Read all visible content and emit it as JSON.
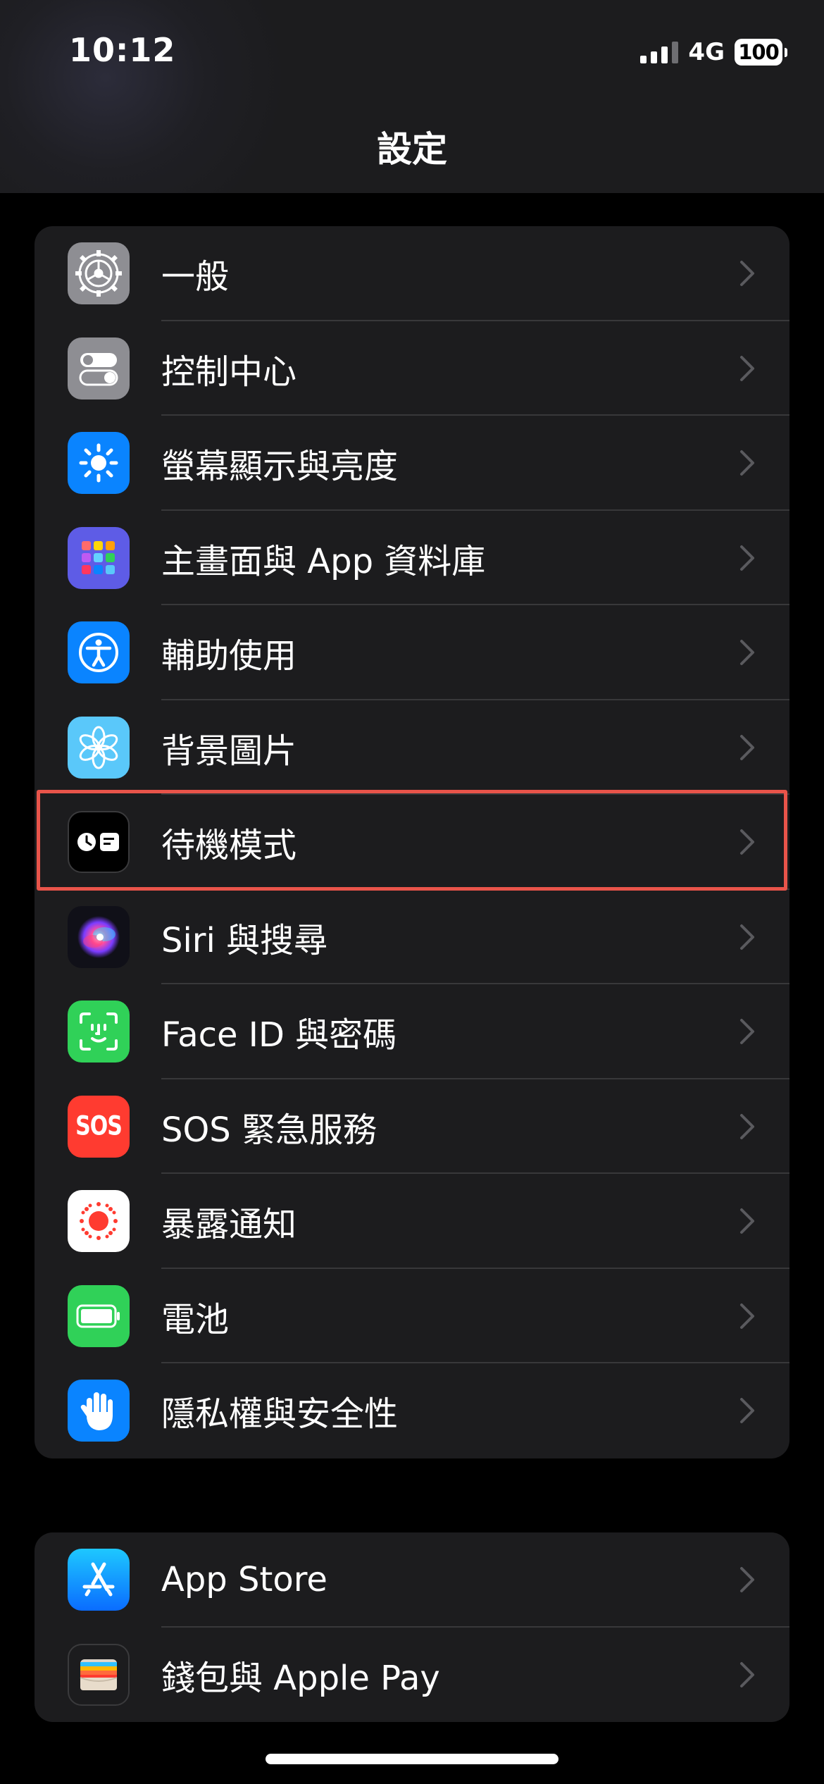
{
  "status_bar": {
    "time": "10:12",
    "network": "4G",
    "battery": "100"
  },
  "nav": {
    "title": "設定"
  },
  "group1": [
    {
      "id": "general",
      "label": "一般",
      "icon": "gear-icon",
      "color": "#8e8e93"
    },
    {
      "id": "control-center",
      "label": "控制中心",
      "icon": "toggles-icon",
      "color": "#8e8e93"
    },
    {
      "id": "display-brightness",
      "label": "螢幕顯示與亮度",
      "icon": "sun-icon",
      "color": "#0a84ff"
    },
    {
      "id": "home-screen",
      "label": "主畫面與 App 資料庫",
      "icon": "app-grid-icon",
      "color": "#5e5ce6"
    },
    {
      "id": "accessibility",
      "label": "輔助使用",
      "icon": "accessibility-icon",
      "color": "#0a84ff"
    },
    {
      "id": "wallpaper",
      "label": "背景圖片",
      "icon": "flower-icon",
      "color": "#5ac8fa"
    },
    {
      "id": "standby",
      "label": "待機模式",
      "icon": "standby-icon",
      "color": "#000000"
    },
    {
      "id": "siri",
      "label": "Siri 與搜尋",
      "icon": "siri-icon",
      "color": "#1b1b2e"
    },
    {
      "id": "face-id",
      "label": "Face ID 與密碼",
      "icon": "face-id-icon",
      "color": "#30d158"
    },
    {
      "id": "sos",
      "label": "SOS 緊急服務",
      "icon": "sos-icon",
      "icon_text": "SOS",
      "color": "#ff3b30"
    },
    {
      "id": "exposure",
      "label": "暴露通知",
      "icon": "exposure-icon",
      "color": "#ffffff"
    },
    {
      "id": "battery",
      "label": "電池",
      "icon": "battery-icon",
      "color": "#30d158"
    },
    {
      "id": "privacy",
      "label": "隱私權與安全性",
      "icon": "hand-icon",
      "color": "#0a84ff"
    }
  ],
  "group2": [
    {
      "id": "app-store",
      "label": "App Store",
      "icon": "app-store-icon",
      "color": "#0a84ff"
    },
    {
      "id": "wallet",
      "label": "錢包與 Apple Pay",
      "icon": "wallet-icon",
      "color": "#1c1c1e"
    }
  ],
  "highlighted_item": "standby"
}
